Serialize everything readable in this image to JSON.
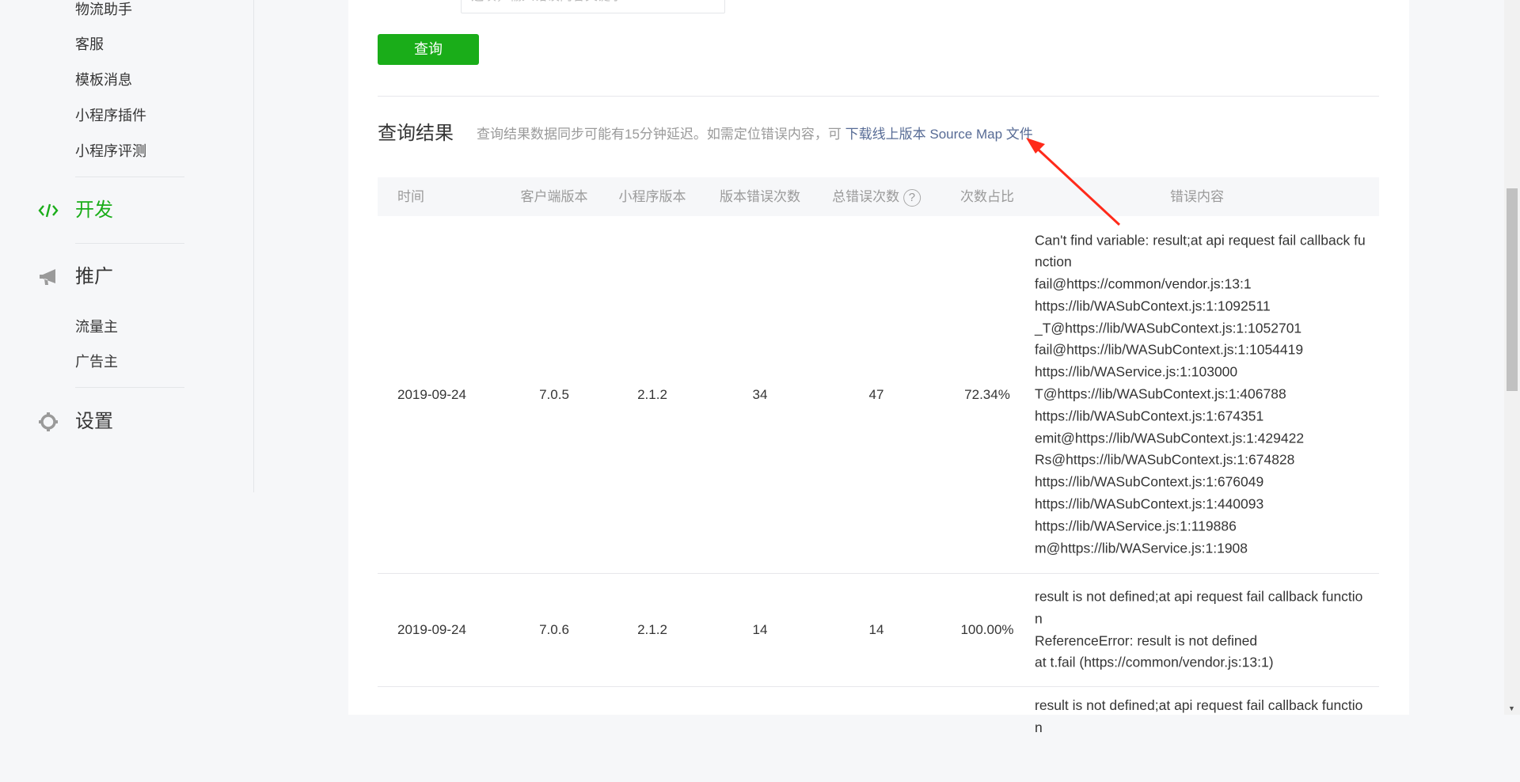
{
  "sidebar": {
    "sub_items_top": [
      "物流助手",
      "客服",
      "模板消息",
      "小程序插件",
      "小程序评测"
    ],
    "dev": {
      "label": "开发",
      "icon": "code-icon",
      "color": "#1aad19"
    },
    "promo": {
      "label": "推广",
      "icon": "megaphone-icon",
      "items": [
        "流量主",
        "广告主"
      ]
    },
    "settings": {
      "label": "设置",
      "icon": "gear-icon"
    }
  },
  "search": {
    "placeholder": "选填，输入错误内容关键字"
  },
  "query_button": "查询",
  "results": {
    "title": "查询结果",
    "desc": "查询结果数据同步可能有15分钟延迟。如需定位错误内容，可",
    "link": "下载线上版本 Source Map 文件"
  },
  "table": {
    "headers": [
      "时间",
      "客户端版本",
      "小程序版本",
      "版本错误次数",
      "总错误次数",
      "次数占比",
      "错误内容"
    ],
    "rows": [
      {
        "time": "2019-09-24",
        "client": "7.0.5",
        "mp": "2.1.2",
        "ver_err": "34",
        "total_err": "47",
        "ratio": "72.34%",
        "error": [
          "Can't find variable: result;at api request fail callback function",
          "fail@https://common/vendor.js:13:1",
          "https://lib/WASubContext.js:1:1092511",
          "_T@https://lib/WASubContext.js:1:1052701",
          "fail@https://lib/WASubContext.js:1:1054419",
          "https://lib/WAService.js:1:103000",
          "T@https://lib/WASubContext.js:1:406788",
          "https://lib/WASubContext.js:1:674351",
          "emit@https://lib/WASubContext.js:1:429422",
          "Rs@https://lib/WASubContext.js:1:674828",
          "https://lib/WASubContext.js:1:676049",
          "https://lib/WASubContext.js:1:440093",
          "https://lib/WAService.js:1:119886",
          "m@https://lib/WAService.js:1:1908"
        ]
      },
      {
        "time": "2019-09-24",
        "client": "7.0.6",
        "mp": "2.1.2",
        "ver_err": "14",
        "total_err": "14",
        "ratio": "100.00%",
        "error": [
          "result is not defined;at api request fail callback function",
          "ReferenceError: result is not defined",
          "at t.fail (https://common/vendor.js:13:1)"
        ]
      },
      {
        "time": "",
        "client": "",
        "mp": "",
        "ver_err": "",
        "total_err": "",
        "ratio": "",
        "error": [
          "result is not defined;at api request fail callback function"
        ]
      }
    ]
  },
  "annotation_color": "#ff2a1a"
}
